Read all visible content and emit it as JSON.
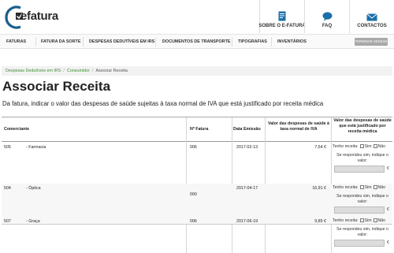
{
  "header": {
    "logo_text": "efatura",
    "links": [
      {
        "label": "SOBRE O E-FATURA",
        "icon": "document-icon"
      },
      {
        "label": "FAQ",
        "icon": "speech-bubble-icon"
      },
      {
        "label": "CONTACTOS",
        "icon": "envelope-icon"
      }
    ]
  },
  "nav": {
    "items": [
      "FATURAS",
      "FATURA DA SORTE",
      "DESPESAS DEDUTÍVEIS EM IRS",
      "DOCUMENTOS DE TRANSPORTE",
      "TIPOGRAFIAS",
      "INVENTÁRIOS"
    ],
    "button": "TERMINAR SESSÃO"
  },
  "breadcrumb": {
    "items": [
      "Despesas Dedutíveis em IRS",
      "Consumidor"
    ],
    "current": "Associar Receita"
  },
  "page": {
    "title": "Associar Receita",
    "subtitle": "Da fatura, indicar o valor das despesas de saúde sujeitas à taxa normal de IVA que está justificado por receita médica"
  },
  "table": {
    "headers": {
      "merchant": "Comerciante",
      "invoice_no": "Nº Fatura",
      "date": "Data Emissão",
      "amount": "Valor das despesas de saúde à taxa normal de IVA",
      "justified": "Valor das despesas de saúde que está justificado por receita médica"
    },
    "question": "Tenho receita:",
    "yes": "Sim",
    "no": "Não",
    "hint": "Se respondeu sim, indique o valor:",
    "currency": "€",
    "rows": [
      {
        "nif": "505",
        "name": "- Farmacia",
        "invoice": "006",
        "date": "2017-02-13",
        "amount": "7,54 €"
      },
      {
        "nif": "504",
        "name": "- Óptica",
        "invoice": "000",
        "date": "2017-04-17",
        "amount": "16,91 €"
      },
      {
        "nif": "507",
        "name": "- Graça",
        "invoice": "006",
        "date": "2017-06-19",
        "amount": "9,85 €"
      }
    ]
  },
  "colors": {
    "accent": "#1b5e8c",
    "breadcrumb_link": "#3f8f33",
    "button": "#a8a8a8"
  }
}
